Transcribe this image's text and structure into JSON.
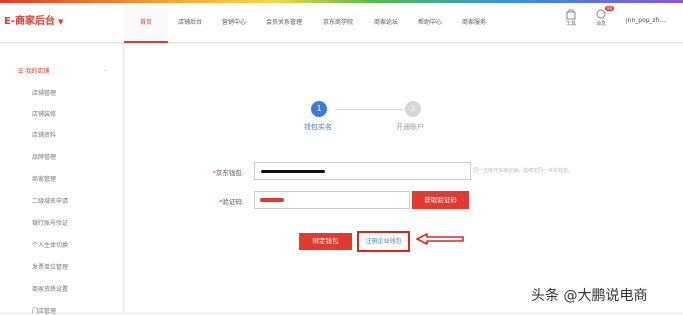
{
  "header": {
    "brand": "E-商家后台",
    "nav": [
      "首页",
      "店铺后台",
      "营销中心",
      "会员关系管理",
      "京东商学院",
      "商家论坛",
      "帮助中心",
      "商家服务"
    ],
    "tools": [
      {
        "icon": "shop-icon",
        "label": "工具"
      },
      {
        "icon": "message-icon",
        "label": "消息",
        "badge": "99"
      }
    ],
    "username": "jnn_pop_zh..."
  },
  "sidebar": {
    "title": "我的店铺",
    "items": [
      "店铺管理",
      "店铺装修",
      "店铺资料",
      "品牌管理",
      "商家管理",
      "二级域名申请",
      "银行账号验证",
      "个人主体切换",
      "发票单位管理",
      "商家资质设置",
      "门店管理"
    ]
  },
  "steps": [
    {
      "num": "1",
      "label": "钱包实名",
      "active": true
    },
    {
      "num": "2",
      "label": "开通账户",
      "active": false
    }
  ],
  "form": {
    "wallet_label": "京东钱包:",
    "code_label": "验证码:",
    "hint": "同一主体开多家店铺，需绑定同一京东钱包。",
    "get_code_button": "获取验证码",
    "bind_button": "绑定钱包",
    "register_button": "注册企业钱包"
  },
  "watermark": "头条 @大鹏说电商",
  "colors": {
    "accent": "#e23a2e",
    "link": "#3a7dd8"
  }
}
